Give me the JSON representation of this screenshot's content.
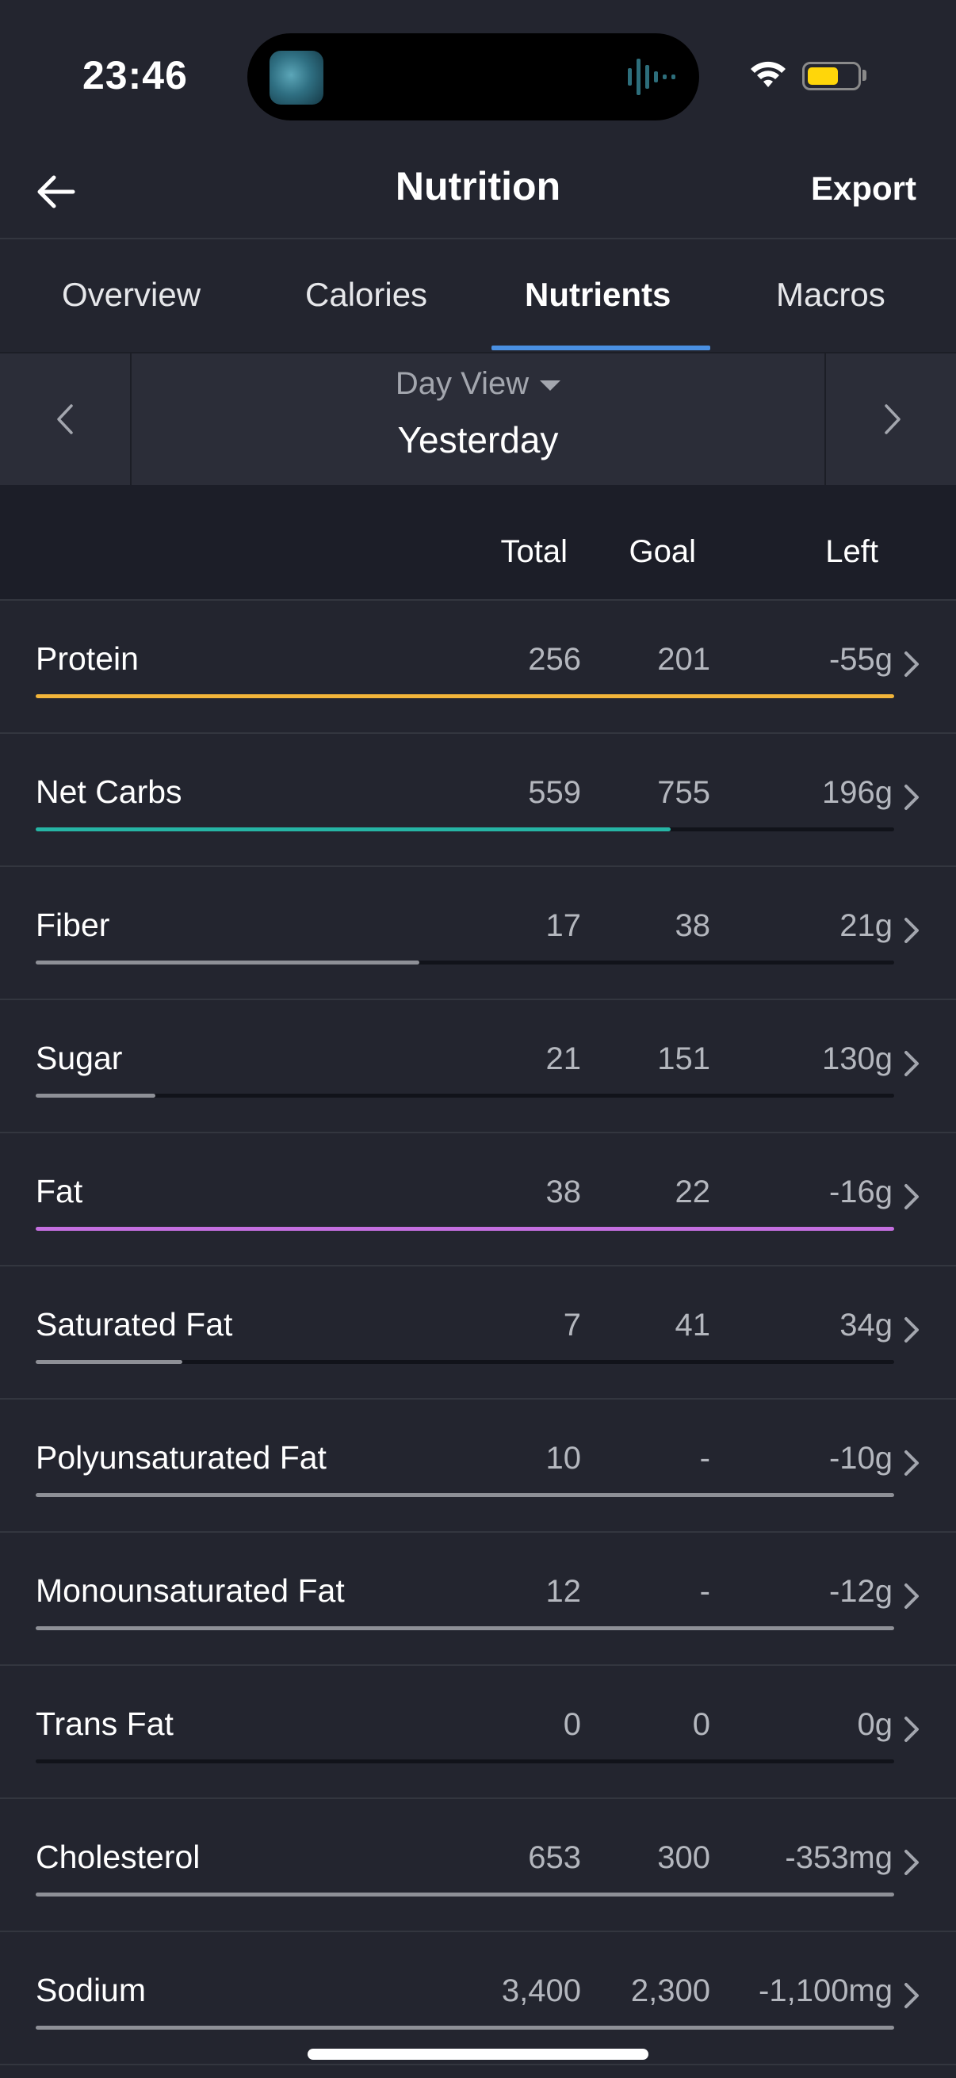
{
  "status": {
    "time": "23:46",
    "battery_color": "#ffd60a"
  },
  "header": {
    "title": "Nutrition",
    "export_label": "Export",
    "back_icon": "back-arrow-icon"
  },
  "tabs": [
    {
      "label": "Overview",
      "active": false
    },
    {
      "label": "Calories",
      "active": false
    },
    {
      "label": "Nutrients",
      "active": true
    },
    {
      "label": "Macros",
      "active": false
    }
  ],
  "day_nav": {
    "view_label": "Day View",
    "day_label": "Yesterday"
  },
  "columns": {
    "total": "Total",
    "goal": "Goal",
    "left": "Left"
  },
  "nutrients": [
    {
      "name": "Protein",
      "total": "256",
      "goal": "201",
      "left": "-55g",
      "progress": 1.0,
      "color": "#f2b53a"
    },
    {
      "name": "Net Carbs",
      "total": "559",
      "goal": "755",
      "left": "196g",
      "progress": 0.74,
      "color": "#26b5a5"
    },
    {
      "name": "Fiber",
      "total": "17",
      "goal": "38",
      "left": "21g",
      "progress": 0.447,
      "color": "#8e9097"
    },
    {
      "name": "Sugar",
      "total": "21",
      "goal": "151",
      "left": "130g",
      "progress": 0.139,
      "color": "#8e9097"
    },
    {
      "name": "Fat",
      "total": "38",
      "goal": "22",
      "left": "-16g",
      "progress": 1.0,
      "color": "#c46fe0"
    },
    {
      "name": "Saturated Fat",
      "total": "7",
      "goal": "41",
      "left": "34g",
      "progress": 0.171,
      "color": "#8e9097"
    },
    {
      "name": "Polyunsaturated Fat",
      "total": "10",
      "goal": "-",
      "left": "-10g",
      "progress": 1.0,
      "color": "#8e9097"
    },
    {
      "name": "Monounsaturated Fat",
      "total": "12",
      "goal": "-",
      "left": "-12g",
      "progress": 1.0,
      "color": "#8e9097"
    },
    {
      "name": "Trans Fat",
      "total": "0",
      "goal": "0",
      "left": "0g",
      "progress": 0.0,
      "color": "#8e9097"
    },
    {
      "name": "Cholesterol",
      "total": "653",
      "goal": "300",
      "left": "-353mg",
      "progress": 1.0,
      "color": "#8e9097"
    },
    {
      "name": "Sodium",
      "total": "3,400",
      "goal": "2,300",
      "left": "-1,100mg",
      "progress": 1.0,
      "color": "#8e9097"
    }
  ]
}
